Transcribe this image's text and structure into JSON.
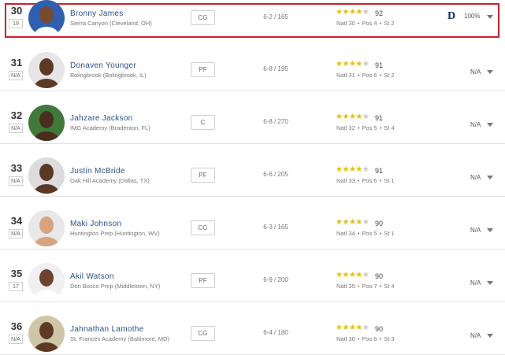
{
  "colors": {
    "highlight": "#d0202a",
    "name": "#2a4f8a",
    "star": "#e5c100",
    "star_empty": "#c8c8c8"
  },
  "players": [
    {
      "rank": "30",
      "prev_rank": "19",
      "name": "Bronny James",
      "school": "Sierra Canyon (Cleveland, OH)",
      "position": "CG",
      "height_weight": "6-2 / 165",
      "stars": 4,
      "rating": "92",
      "natl": "Natl 30",
      "pos_rank": "Pos 4",
      "st_rank": "St 2",
      "prediction": "100%",
      "prediction_logo": "D",
      "highlighted": true
    },
    {
      "rank": "31",
      "prev_rank": "N/A",
      "name": "Donaven Younger",
      "school": "Bolingbrook (Bolingbrook, IL)",
      "position": "PF",
      "height_weight": "6-8 / 195",
      "stars": 4,
      "rating": "91",
      "natl": "Natl 31",
      "pos_rank": "Pos 6",
      "st_rank": "St 2",
      "prediction": "N/A"
    },
    {
      "rank": "32",
      "prev_rank": "N/A",
      "name": "Jahzare Jackson",
      "school": "IMG Academy (Bradenton, FL)",
      "position": "C",
      "height_weight": "6-8 / 270",
      "stars": 4,
      "rating": "91",
      "natl": "Natl 32",
      "pos_rank": "Pos 5",
      "st_rank": "St 4",
      "prediction": "N/A"
    },
    {
      "rank": "33",
      "prev_rank": "N/A",
      "name": "Justin McBride",
      "school": "Oak Hill Academy (Dallas, TX)",
      "position": "PF",
      "height_weight": "6-6 / 205",
      "stars": 4,
      "rating": "91",
      "natl": "Natl 33",
      "pos_rank": "Pos 6",
      "st_rank": "St 1",
      "prediction": "N/A"
    },
    {
      "rank": "34",
      "prev_rank": "N/A",
      "name": "Maki Johnson",
      "school": "Huntington Prep (Huntington, WV)",
      "position": "CG",
      "height_weight": "6-3 / 165",
      "stars": 4,
      "rating": "90",
      "natl": "Natl 34",
      "pos_rank": "Pos 5",
      "st_rank": "St 1",
      "prediction": "N/A"
    },
    {
      "rank": "35",
      "prev_rank": "17",
      "name": "Akil Watson",
      "school": "Don Bosco Prep (Middletown, NY)",
      "position": "PF",
      "height_weight": "6-9 / 200",
      "stars": 4,
      "rating": "90",
      "natl": "Natl 35",
      "pos_rank": "Pos 7",
      "st_rank": "St 4",
      "prediction": "N/A"
    },
    {
      "rank": "36",
      "prev_rank": "N/A",
      "name": "Jahnathan Lamothe",
      "school": "St. Frances Academy (Baltimore, MD)",
      "position": "CG",
      "height_weight": "6-4 / 180",
      "stars": 4,
      "rating": "90",
      "natl": "Natl 36",
      "pos_rank": "Pos 6",
      "st_rank": "St 3",
      "prediction": "N/A"
    }
  ]
}
